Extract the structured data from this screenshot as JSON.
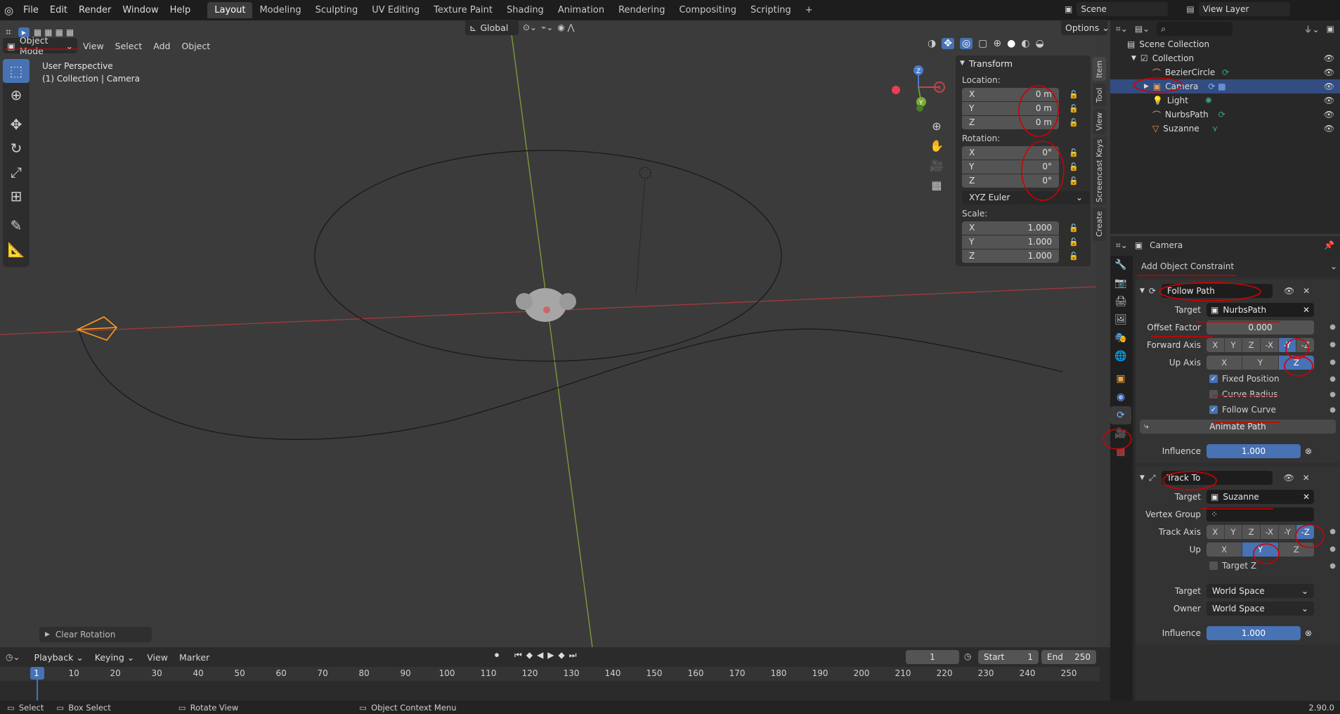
{
  "topbar": {
    "menus": [
      "File",
      "Edit",
      "Render",
      "Window",
      "Help"
    ],
    "workspaces": [
      "Layout",
      "Modeling",
      "Sculpting",
      "UV Editing",
      "Texture Paint",
      "Shading",
      "Animation",
      "Rendering",
      "Compositing",
      "Scripting"
    ],
    "active_workspace": "Layout",
    "add_tab": "+",
    "scene_label": "Scene",
    "view_layer_label": "View Layer"
  },
  "viewport": {
    "mode": "Object Mode",
    "menus": [
      "View",
      "Select",
      "Add",
      "Object"
    ],
    "orientation": "Global",
    "options": "Options",
    "perspective": "User Perspective",
    "collection_info": "(1) Collection | Camera",
    "last_op": "Clear Rotation"
  },
  "gizmo": {
    "x": "X",
    "y": "Y",
    "z": "Z"
  },
  "npanel": {
    "title": "Transform",
    "location_label": "Location:",
    "location": [
      {
        "axis": "X",
        "value": "0 m"
      },
      {
        "axis": "Y",
        "value": "0 m"
      },
      {
        "axis": "Z",
        "value": "0 m"
      }
    ],
    "rotation_label": "Rotation:",
    "rotation": [
      {
        "axis": "X",
        "value": "0°"
      },
      {
        "axis": "Y",
        "value": "0°"
      },
      {
        "axis": "Z",
        "value": "0°"
      }
    ],
    "rotation_mode": "XYZ Euler",
    "scale_label": "Scale:",
    "scale": [
      {
        "axis": "X",
        "value": "1.000"
      },
      {
        "axis": "Y",
        "value": "1.000"
      },
      {
        "axis": "Z",
        "value": "1.000"
      }
    ],
    "tabs": [
      "Item",
      "Tool",
      "View",
      "Screencast Keys",
      "Create"
    ]
  },
  "outliner": {
    "root": "Scene Collection",
    "collection": "Collection",
    "items": [
      "BezierCircle",
      "Camera",
      "Light",
      "NurbsPath",
      "Suzanne"
    ],
    "selected": "Camera"
  },
  "properties": {
    "object_name": "Camera",
    "add_constraint": "Add Object Constraint",
    "follow_path": {
      "name": "Follow Path",
      "target_label": "Target",
      "target": "NurbsPath",
      "offset_label": "Offset Factor",
      "offset": "0.000",
      "forward_label": "Forward Axis",
      "forward_axes": [
        "X",
        "Y",
        "Z",
        "-X",
        "-Y",
        "-Z"
      ],
      "forward_active": "-Y",
      "up_label": "Up Axis",
      "up_axes": [
        "X",
        "Y",
        "Z"
      ],
      "up_active": "Z",
      "fixed_position": "Fixed Position",
      "curve_radius": "Curve Radius",
      "follow_curve": "Follow Curve",
      "animate_path": "Animate Path",
      "influence_label": "Influence",
      "influence": "1.000"
    },
    "track_to": {
      "name": "Track To",
      "target_label": "Target",
      "target": "Suzanne",
      "vgroup_label": "Vertex Group",
      "track_label": "Track Axis",
      "track_axes": [
        "X",
        "Y",
        "Z",
        "-X",
        "-Y",
        "-Z"
      ],
      "track_active": "-Z",
      "up_label": "Up",
      "up_axes": [
        "X",
        "Y",
        "Z"
      ],
      "up_active": "Y",
      "target_z": "Target Z",
      "target_space_label": "Target",
      "target_space": "World Space",
      "owner_space_label": "Owner",
      "owner_space": "World Space",
      "influence_label": "Influence",
      "influence": "1.000"
    }
  },
  "timeline": {
    "menus": [
      "Playback",
      "Keying",
      "View",
      "Marker"
    ],
    "current_frame": "1",
    "start_label": "Start",
    "start": "1",
    "end_label": "End",
    "end": "250",
    "ticks": [
      "1",
      "10",
      "20",
      "30",
      "40",
      "50",
      "60",
      "70",
      "80",
      "90",
      "100",
      "110",
      "120",
      "130",
      "140",
      "150",
      "160",
      "170",
      "180",
      "190",
      "200",
      "210",
      "220",
      "230",
      "240",
      "250"
    ]
  },
  "statusbar": {
    "select": "Select",
    "box_select": "Box Select",
    "rotate_view": "Rotate View",
    "context_menu": "Object Context Menu",
    "version": "2.90.0"
  }
}
